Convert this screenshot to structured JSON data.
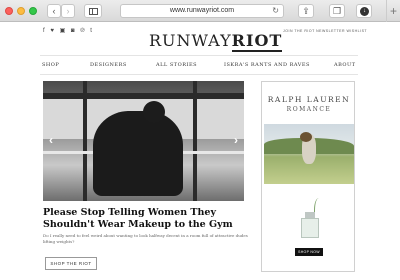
{
  "browser": {
    "url": "www.runwayriot.com",
    "icons": [
      "back-icon",
      "forward-icon",
      "sidebar-icon",
      "reload-icon",
      "share-icon",
      "tabs-icon",
      "download-icon",
      "new-tab-icon"
    ]
  },
  "header": {
    "social": "f ♥ ▣ ◙ ℗ t",
    "logo_part1": "RUNWAY",
    "logo_part2": "RIOT",
    "newsletter": "JOIN THE RIOT NEWSLETTER   WISHLIST"
  },
  "nav": {
    "items": [
      "SHOP",
      "DESIGNERS",
      "ALL STORIES",
      "ISKRA'S RANTS AND RAVES",
      "ABOUT"
    ]
  },
  "article": {
    "headline": "Please Stop Telling Women They Shouldn't Wear Makeup to the Gym",
    "excerpt": "Do I really need to feel weird about wanting to look halfway decent in a room full of attractive dudes lifting weights?",
    "cta": "SHOP THE RIOT",
    "prev_arrow": "‹",
    "next_arrow": "›"
  },
  "ad": {
    "brand": "RALPH LAUREN",
    "subtitle": "ROMANCE",
    "cta": "SHOP NOW"
  },
  "colors": {
    "chrome": "#dcdcdc",
    "text": "#222222",
    "close": "#fc605c",
    "minimize": "#fdbc40",
    "maximize": "#34c84a"
  }
}
